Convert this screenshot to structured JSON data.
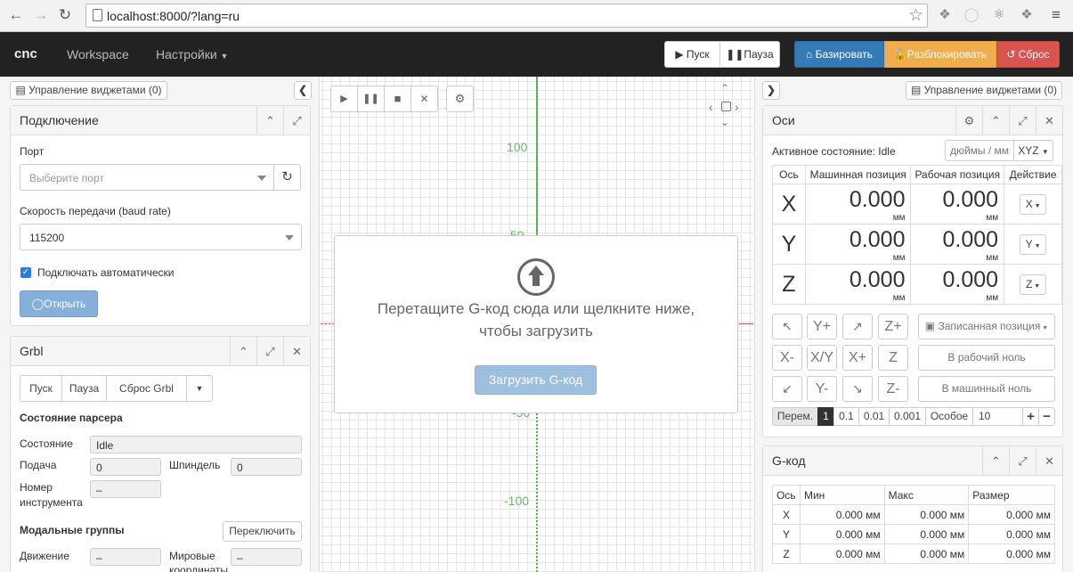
{
  "browser": {
    "url": "localhost:8000/?lang=ru"
  },
  "navbar": {
    "brand": "cnc",
    "workspace": "Workspace",
    "settings": "Настройки",
    "start": "Пуск",
    "pause": "Пауза",
    "home": "Базировать",
    "unlock": "Разблокировать",
    "reset": "Сброс",
    "colors": {
      "home": "#337ab7",
      "unlock": "#f0ad4e",
      "reset": "#d9534f"
    }
  },
  "left": {
    "manage_widgets": "Управление виджетами (0)",
    "connection": {
      "title": "Подключение",
      "port_label": "Порт",
      "port_placeholder": "Выберите порт",
      "baud_label": "Скорость передачи (baud rate)",
      "baud_value": "115200",
      "auto_connect": "Подключать автоматически",
      "open_button": "Открыть"
    },
    "grbl": {
      "title": "Grbl",
      "btn_start": "Пуск",
      "btn_pause": "Пауза",
      "btn_reset": "Сброс Grbl",
      "parser_state": "Состояние парсера",
      "state_label": "Состояние",
      "state_value": "Idle",
      "feed_label": "Подача",
      "feed_value": "0",
      "spindle_label": "Шпиндель",
      "spindle_value": "0",
      "tool_label_1": "Номер",
      "tool_label_2": "инструмента",
      "tool_value": "–",
      "modal_groups": "Модальные группы",
      "toggle": "Переключить",
      "motion_label": "Движение",
      "motion_value": "–",
      "wcs_label_1": "Мировые",
      "wcs_label_2": "координаты",
      "wcs_value": "–"
    }
  },
  "center": {
    "ticks": [
      "100",
      "50",
      "-50",
      "-100"
    ],
    "drop_text_1": "Перетащите G-код сюда или щелкните ниже,",
    "drop_text_2": "чтобы загрузить",
    "load_button": "Загрузить G-код"
  },
  "right": {
    "manage_widgets": "Управление виджетами (0)",
    "axes": {
      "title": "Оси",
      "active_state": "Активное состояние: Idle",
      "units": "дюймы / мм",
      "plane": "XYZ",
      "col_axis": "Ось",
      "col_machine": "Машинная позиция",
      "col_work": "Рабочая позиция",
      "col_action": "Действие",
      "unit": "мм",
      "rows": [
        {
          "axis": "X",
          "machine": "0.000",
          "work": "0.000",
          "action": "X"
        },
        {
          "axis": "Y",
          "machine": "0.000",
          "work": "0.000",
          "action": "Y"
        },
        {
          "axis": "Z",
          "machine": "0.000",
          "work": "0.000",
          "action": "Z"
        }
      ],
      "jog": {
        "yplus": "Y+",
        "zplus": "Z+",
        "xminus": "X-",
        "xy": "X/Y",
        "xplus": "X+",
        "z": "Z",
        "yminus": "Y-",
        "zminus": "Z-",
        "saved_pos": "Записанная позиция",
        "to_work_zero": "В рабочий ноль",
        "to_machine_zero": "В машинный ноль"
      },
      "step_label": "Перем.",
      "steps": [
        "1",
        "0.1",
        "0.01",
        "0.001"
      ],
      "custom_label": "Особое",
      "custom_value": "10"
    },
    "gcode": {
      "title": "G-код",
      "col_axis": "Ось",
      "col_min": "Мин",
      "col_max": "Макс",
      "col_size": "Размер",
      "rows": [
        {
          "axis": "X",
          "min": "0.000 мм",
          "max": "0.000 мм",
          "size": "0.000 мм"
        },
        {
          "axis": "Y",
          "min": "0.000 мм",
          "max": "0.000 мм",
          "size": "0.000 мм"
        },
        {
          "axis": "Z",
          "min": "0.000 мм",
          "max": "0.000 мм",
          "size": "0.000 мм"
        }
      ]
    }
  }
}
